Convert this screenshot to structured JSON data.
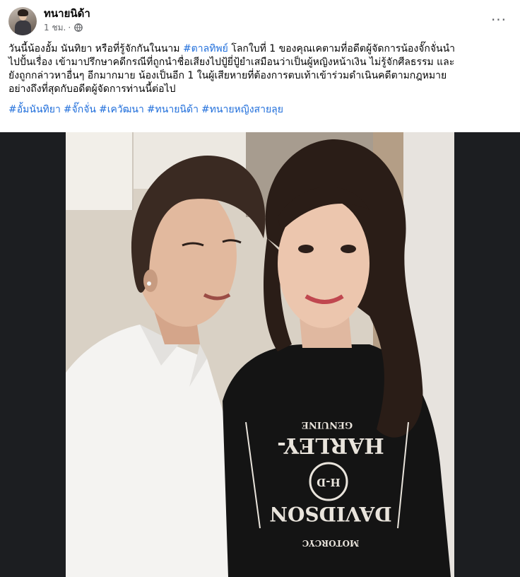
{
  "post": {
    "author": "ทนายนิด้า",
    "time": "1 ชม.",
    "separator": "·",
    "privacy_icon": "globe-icon",
    "more_icon": "more-dots-icon",
    "more_label": "···",
    "text_segments": [
      {
        "text": "วันนี้น้องอั้ม นันทิยา หรือที่รู้จักกันในนาม ",
        "type": "text"
      },
      {
        "text": "#ตาลทิพย์",
        "type": "hashtag"
      },
      {
        "text": " โลกใบที่ 1 ของคุณเคตามที่อดีตผู้จัดการน้องจั๊กจั่นนำ\nไปปั้นเรื่อง เข้ามาปรึกษาคดีกรณีที่ถูกนำชื่อเสียงไปปู้ยี่ปู้ยำเสมือนว่าเป็นผู้หญิงหน้าเงิน ไม่รู้จักศีลธรรม และ\nยังถูกกล่าวหาอื่นๆ อีกมากมาย น้องเป็นอีก 1 ในผู้เสียหายที่ต้องการตบเท้าเข้าร่วมดำเนินคดีตามกฎหมาย\nอย่างถึงที่สุดกับอดีตผู้จัดการท่านนี้ต่อไป",
        "type": "text"
      }
    ],
    "hashtags": [
      "#อั้มนันทิยา",
      "#จั๊กจั่น",
      "#เควัฒนา",
      "#ทนายนิด้า",
      "#ทนายหญิงสายลุย"
    ]
  },
  "photo": {
    "shirt_text_top": "GENUINE",
    "shirt_text_main_1": "HARLEY-",
    "shirt_text_mid": "H-D",
    "shirt_text_main_2": "DAVIDSON",
    "shirt_text_bottom": "MOTORCYC"
  },
  "colors": {
    "hashtag": "#216fdb",
    "secondary_text": "#65676b",
    "photo_letterbox": "#1c1e21"
  }
}
